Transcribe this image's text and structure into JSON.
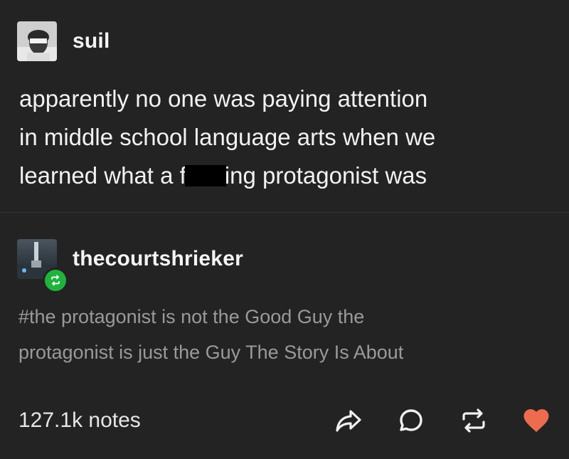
{
  "post": {
    "author": "suil",
    "body_lines": [
      {
        "text": "apparently no one was paying attention"
      },
      {
        "text": "in middle school language arts when we"
      },
      {
        "before": "learned what a f",
        "after": "ing protagonist was"
      }
    ]
  },
  "reblog": {
    "author": "thecourtshrieker",
    "tag_lines": [
      "#the protagonist is not the Good Guy the",
      "protagonist is just the Guy The Story Is About"
    ]
  },
  "footer": {
    "notes": "127.1k notes"
  },
  "icons": {
    "share": "share-icon",
    "reply": "reply-icon",
    "reblog": "reblog-icon",
    "like": "heart-icon",
    "reblog_badge": "reblog-badge-icon"
  },
  "colors": {
    "background": "#232323",
    "like": "#ed6b4f",
    "reblog_badge": "#1fb33e",
    "tags": "#9a9a9a"
  }
}
